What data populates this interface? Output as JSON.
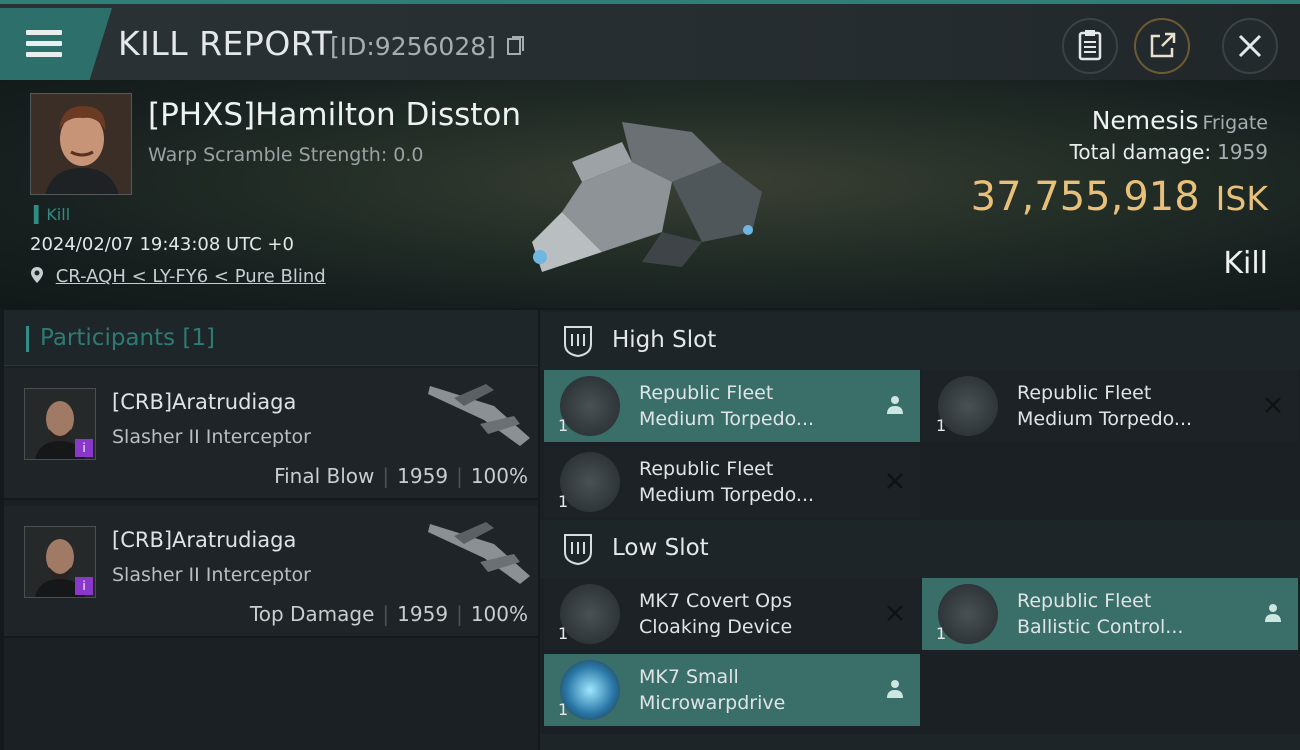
{
  "title_bar": {
    "title": "KILL REPORT",
    "report_id": "[ID:9256028]"
  },
  "victim": {
    "name": "[PHXS]Hamilton Disston",
    "warp_scramble": "Warp Scramble Strength: 0.0",
    "tag": "Kill",
    "timestamp": "2024/02/07 19:43:08 UTC +0",
    "location": "CR-AQH < LY-FY6 < Pure Blind",
    "ship_name": "Nemesis",
    "ship_class": "Frigate",
    "total_damage_label": "Total damage:",
    "total_damage_value": "1959",
    "isk_value": "37,755,918",
    "isk_unit": "ISK",
    "result_label": "Kill"
  },
  "participants": {
    "header": "Participants [1]",
    "items": [
      {
        "name": "[CRB]Aratrudiaga",
        "ship": "Slasher II Interceptor",
        "role": "Final Blow",
        "damage": "1959",
        "percent": "100%"
      },
      {
        "name": "[CRB]Aratrudiaga",
        "ship": "Slasher II Interceptor",
        "role": "Top Damage",
        "damage": "1959",
        "percent": "100%"
      }
    ]
  },
  "fitting": {
    "high_slot_label": "High Slot",
    "low_slot_label": "Low Slot",
    "high_modules": [
      {
        "line1": "Republic Fleet",
        "line2": "Medium Torpedo...",
        "qty": "1",
        "state": "dropped"
      },
      {
        "line1": "Republic Fleet",
        "line2": "Medium Torpedo...",
        "qty": "1",
        "state": "destroyed"
      },
      {
        "line1": "Republic Fleet",
        "line2": "Medium Torpedo...",
        "qty": "1",
        "state": "destroyed"
      }
    ],
    "low_modules": [
      {
        "line1": "MK7 Covert Ops",
        "line2": "Cloaking Device",
        "qty": "1",
        "state": "destroyed"
      },
      {
        "line1": "Republic Fleet",
        "line2": "Ballistic Control...",
        "qty": "1",
        "state": "dropped"
      },
      {
        "line1": "MK7 Small",
        "line2": "Microwarpdrive",
        "qty": "1",
        "state": "dropped"
      }
    ]
  },
  "colors": {
    "accent": "#2f8f86",
    "isk": "#e8c07a",
    "dropped_bg": "#3a6e68"
  }
}
